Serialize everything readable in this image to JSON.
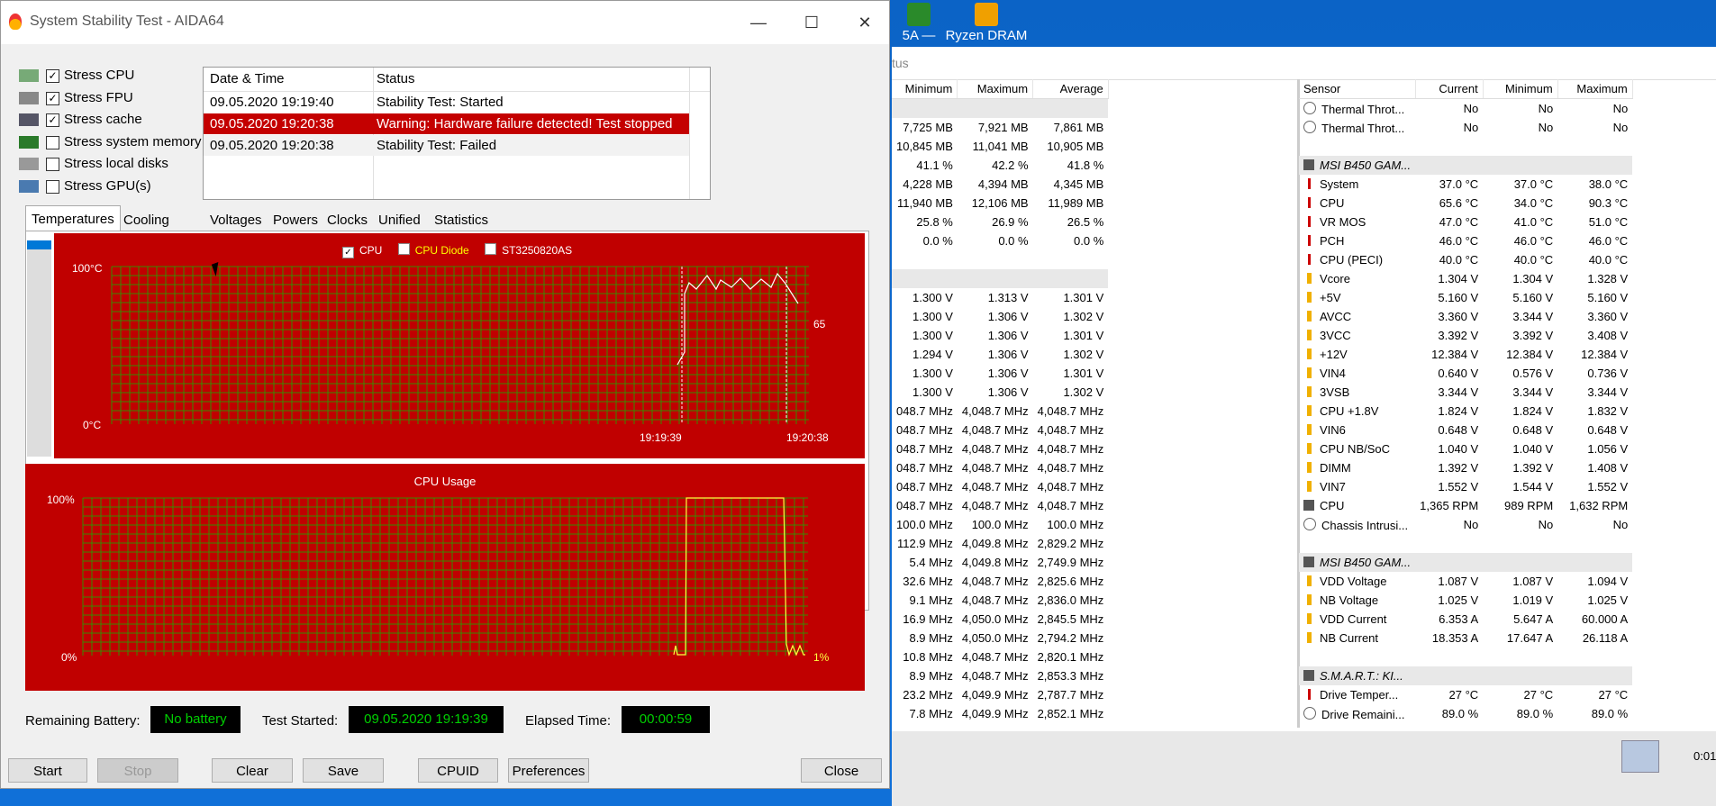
{
  "desktop": {
    "icons": [
      {
        "label": "5A —"
      },
      {
        "label": "Ryzen DRAM"
      }
    ]
  },
  "hwinfo": {
    "header_text": "tus",
    "left_headers": [
      "Minimum",
      "Maximum",
      "Average"
    ],
    "left_rows": [
      {
        "g": true,
        "v": [
          "",
          "",
          ""
        ]
      },
      {
        "v": [
          "7,725 MB",
          "7,921 MB",
          "7,861 MB"
        ]
      },
      {
        "v": [
          "10,845 MB",
          "11,041 MB",
          "10,905 MB"
        ]
      },
      {
        "v": [
          "41.1 %",
          "42.2 %",
          "41.8 %"
        ]
      },
      {
        "v": [
          "4,228 MB",
          "4,394 MB",
          "4,345 MB"
        ]
      },
      {
        "v": [
          "11,940 MB",
          "12,106 MB",
          "11,989 MB"
        ]
      },
      {
        "v": [
          "25.8 %",
          "26.9 %",
          "26.5 %"
        ]
      },
      {
        "v": [
          "0.0 %",
          "0.0 %",
          "0.0 %"
        ]
      },
      {
        "v": [
          "",
          "",
          ""
        ]
      },
      {
        "g": true,
        "v": [
          "",
          "",
          ""
        ]
      },
      {
        "v": [
          "1.300 V",
          "1.313 V",
          "1.301 V"
        ]
      },
      {
        "v": [
          "1.300 V",
          "1.306 V",
          "1.302 V"
        ]
      },
      {
        "v": [
          "1.300 V",
          "1.306 V",
          "1.301 V"
        ]
      },
      {
        "v": [
          "1.294 V",
          "1.306 V",
          "1.302 V"
        ]
      },
      {
        "v": [
          "1.300 V",
          "1.306 V",
          "1.301 V"
        ]
      },
      {
        "v": [
          "1.300 V",
          "1.306 V",
          "1.302 V"
        ]
      },
      {
        "v": [
          "048.7 MHz",
          "4,048.7 MHz",
          "4,048.7 MHz"
        ]
      },
      {
        "v": [
          "048.7 MHz",
          "4,048.7 MHz",
          "4,048.7 MHz"
        ]
      },
      {
        "v": [
          "048.7 MHz",
          "4,048.7 MHz",
          "4,048.7 MHz"
        ]
      },
      {
        "v": [
          "048.7 MHz",
          "4,048.7 MHz",
          "4,048.7 MHz"
        ]
      },
      {
        "v": [
          "048.7 MHz",
          "4,048.7 MHz",
          "4,048.7 MHz"
        ]
      },
      {
        "v": [
          "048.7 MHz",
          "4,048.7 MHz",
          "4,048.7 MHz"
        ]
      },
      {
        "v": [
          "100.0 MHz",
          "100.0 MHz",
          "100.0 MHz"
        ]
      },
      {
        "v": [
          "112.9 MHz",
          "4,049.8 MHz",
          "2,829.2 MHz"
        ]
      },
      {
        "v": [
          "5.4 MHz",
          "4,049.8 MHz",
          "2,749.9 MHz"
        ]
      },
      {
        "v": [
          "32.6 MHz",
          "4,048.7 MHz",
          "2,825.6 MHz"
        ]
      },
      {
        "v": [
          "9.1 MHz",
          "4,048.7 MHz",
          "2,836.0 MHz"
        ]
      },
      {
        "v": [
          "16.9 MHz",
          "4,050.0 MHz",
          "2,845.5 MHz"
        ]
      },
      {
        "v": [
          "8.9 MHz",
          "4,050.0 MHz",
          "2,794.2 MHz"
        ]
      },
      {
        "v": [
          "10.8 MHz",
          "4,048.7 MHz",
          "2,820.1 MHz"
        ]
      },
      {
        "v": [
          "8.9 MHz",
          "4,048.7 MHz",
          "2,853.3 MHz"
        ]
      },
      {
        "v": [
          "23.2 MHz",
          "4,049.9 MHz",
          "2,787.7 MHz"
        ]
      },
      {
        "v": [
          "7.8 MHz",
          "4,049.9 MHz",
          "2,852.1 MHz"
        ]
      }
    ],
    "right_headers": [
      "Sensor",
      "Current",
      "Minimum",
      "Maximum"
    ],
    "right_rows": [
      {
        "i": "therm",
        "s": "Thermal Throt...",
        "v": [
          "No",
          "No",
          "No"
        ]
      },
      {
        "i": "therm",
        "s": "Thermal Throt...",
        "v": [
          "No",
          "No",
          "No"
        ]
      },
      {
        "s": "",
        "v": [
          "",
          "",
          ""
        ]
      },
      {
        "g": true,
        "i": "chip",
        "s": "MSI B450 GAM...",
        "v": [
          "",
          "",
          ""
        ]
      },
      {
        "i": "temp",
        "s": "System",
        "v": [
          "37.0 °C",
          "37.0 °C",
          "38.0 °C"
        ]
      },
      {
        "i": "temp",
        "s": "CPU",
        "v": [
          "65.6 °C",
          "34.0 °C",
          "90.3 °C"
        ]
      },
      {
        "i": "temp",
        "s": "VR MOS",
        "v": [
          "47.0 °C",
          "41.0 °C",
          "51.0 °C"
        ]
      },
      {
        "i": "temp",
        "s": "PCH",
        "v": [
          "46.0 °C",
          "46.0 °C",
          "46.0 °C"
        ]
      },
      {
        "i": "temp",
        "s": "CPU (PECI)",
        "v": [
          "40.0 °C",
          "40.0 °C",
          "40.0 °C"
        ]
      },
      {
        "i": "volt",
        "s": "Vcore",
        "v": [
          "1.304 V",
          "1.304 V",
          "1.328 V"
        ]
      },
      {
        "i": "volt",
        "s": "+5V",
        "v": [
          "5.160 V",
          "5.160 V",
          "5.160 V"
        ]
      },
      {
        "i": "volt",
        "s": "AVCC",
        "v": [
          "3.360 V",
          "3.344 V",
          "3.360 V"
        ]
      },
      {
        "i": "volt",
        "s": "3VCC",
        "v": [
          "3.392 V",
          "3.392 V",
          "3.408 V"
        ]
      },
      {
        "i": "volt",
        "s": "+12V",
        "v": [
          "12.384 V",
          "12.384 V",
          "12.384 V"
        ]
      },
      {
        "i": "volt",
        "s": "VIN4",
        "v": [
          "0.640 V",
          "0.576 V",
          "0.736 V"
        ]
      },
      {
        "i": "volt",
        "s": "3VSB",
        "v": [
          "3.344 V",
          "3.344 V",
          "3.344 V"
        ]
      },
      {
        "i": "volt",
        "s": "CPU +1.8V",
        "v": [
          "1.824 V",
          "1.824 V",
          "1.832 V"
        ]
      },
      {
        "i": "volt",
        "s": "VIN6",
        "v": [
          "0.648 V",
          "0.648 V",
          "0.648 V"
        ]
      },
      {
        "i": "volt",
        "s": "CPU NB/SoC",
        "v": [
          "1.040 V",
          "1.040 V",
          "1.056 V"
        ]
      },
      {
        "i": "volt",
        "s": "DIMM",
        "v": [
          "1.392 V",
          "1.392 V",
          "1.408 V"
        ]
      },
      {
        "i": "volt",
        "s": "VIN7",
        "v": [
          "1.552 V",
          "1.544 V",
          "1.552 V"
        ]
      },
      {
        "i": "chip",
        "s": "CPU",
        "v": [
          "1,365 RPM",
          "989 RPM",
          "1,632 RPM"
        ]
      },
      {
        "i": "therm",
        "s": "Chassis Intrusi...",
        "v": [
          "No",
          "No",
          "No"
        ]
      },
      {
        "s": "",
        "v": [
          "",
          "",
          ""
        ]
      },
      {
        "g": true,
        "i": "chip",
        "s": "MSI B450 GAM...",
        "v": [
          "",
          "",
          ""
        ]
      },
      {
        "i": "volt",
        "s": "VDD Voltage",
        "v": [
          "1.087 V",
          "1.087 V",
          "1.094 V"
        ]
      },
      {
        "i": "volt",
        "s": "NB Voltage",
        "v": [
          "1.025 V",
          "1.019 V",
          "1.025 V"
        ]
      },
      {
        "i": "volt",
        "s": "VDD Current",
        "v": [
          "6.353 A",
          "5.647 A",
          "60.000 A"
        ]
      },
      {
        "i": "volt",
        "s": "NB Current",
        "v": [
          "18.353 A",
          "17.647 A",
          "26.118 A"
        ]
      },
      {
        "s": "",
        "v": [
          "",
          "",
          ""
        ]
      },
      {
        "g": true,
        "i": "chip",
        "s": "S.M.A.R.T.: KI...",
        "v": [
          "",
          "",
          ""
        ]
      },
      {
        "i": "temp",
        "s": "Drive Temper...",
        "v": [
          "27 °C",
          "27 °C",
          "27 °C"
        ]
      },
      {
        "i": "therm",
        "s": "Drive Remaini...",
        "v": [
          "89.0 %",
          "89.0 %",
          "89.0 %"
        ]
      }
    ],
    "footer_time": "0:01"
  },
  "window": {
    "title": "System Stability Test - AIDA64",
    "minimize": "—",
    "maximize": "☐",
    "close": "✕"
  },
  "stress": [
    {
      "label": "Stress CPU",
      "checked": true
    },
    {
      "label": "Stress FPU",
      "checked": true
    },
    {
      "label": "Stress cache",
      "checked": true
    },
    {
      "label": "Stress system memory",
      "checked": false
    },
    {
      "label": "Stress local disks",
      "checked": false
    },
    {
      "label": "Stress GPU(s)",
      "checked": false
    }
  ],
  "log": {
    "headers": [
      "Date & Time",
      "Status"
    ],
    "rows": [
      {
        "time": "09.05.2020 19:19:40",
        "status": "Stability Test: Started"
      },
      {
        "time": "09.05.2020 19:20:38",
        "status": "Warning: Hardware failure detected! Test stopped"
      },
      {
        "time": "09.05.2020 19:20:38",
        "status": "Stability Test: Failed"
      }
    ]
  },
  "tabs": [
    "Temperatures",
    "Cooling Fans",
    "Voltages",
    "Powers",
    "Clocks",
    "Unified",
    "Statistics"
  ],
  "temp_graph": {
    "legend": [
      "CPU",
      "CPU Diode",
      "ST3250820AS"
    ],
    "legend_checked": [
      true,
      false,
      false
    ],
    "y_top": "100°C",
    "y_bottom": "0°C",
    "x_labels": [
      "19:19:39",
      "19:20:38"
    ],
    "current_value": "65",
    "colors": {
      "bg": "#c00000",
      "grid": "#3a8a00",
      "line": "#ffffff",
      "legend_alt": "#ffff00"
    }
  },
  "cpu_graph": {
    "title": "CPU Usage",
    "y_top": "100%",
    "y_bottom": "0%",
    "current_value": "1%",
    "colors": {
      "line": "#ffff40"
    }
  },
  "status": {
    "battery_label": "Remaining Battery:",
    "battery_value": "No battery",
    "started_label": "Test Started:",
    "started_value": "09.05.2020 19:19:39",
    "elapsed_label": "Elapsed Time:",
    "elapsed_value": "00:00:59"
  },
  "buttons": {
    "start": "Start",
    "stop": "Stop",
    "clear": "Clear",
    "save": "Save",
    "cpuid": "CPUID",
    "preferences": "Preferences",
    "close": "Close"
  }
}
